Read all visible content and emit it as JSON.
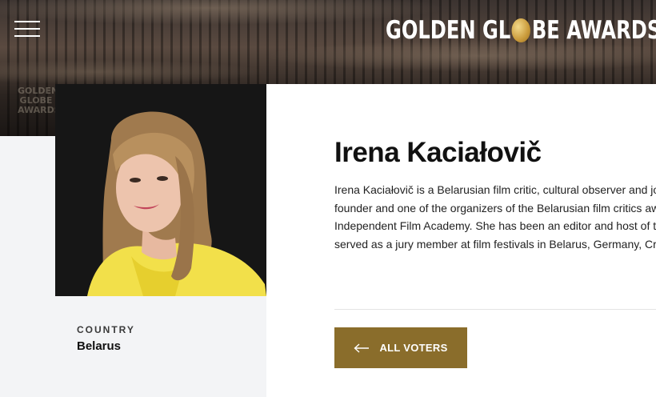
{
  "header": {
    "brand_left": "GOLDEN GL",
    "brand_right": "BE AWARDS",
    "brand_mark": "®",
    "ghost_logo_lines": [
      "GOLDEN",
      "GLOBE",
      "AWARDS"
    ]
  },
  "voter": {
    "name": "Irena Kaciałovič",
    "bio_lines": [
      "Irena Kaciałovič is a Belarusian film critic, cultural observer and journa",
      "founder and one of the organizers of the Belarusian film critics award",
      "Independent Film Academy. She has been an editor and host of the c",
      "served as a jury member at film festivals in Belarus, Germany, Croatia"
    ],
    "country_label": "COUNTRY",
    "country_value": "Belarus"
  },
  "actions": {
    "all_voters_label": "ALL VOTERS"
  },
  "colors": {
    "accent_gold": "#8a6d2b",
    "background_light": "#f3f4f6",
    "content_white": "#ffffff",
    "text_dark": "#111111"
  },
  "icons": {
    "menu": "hamburger-menu-icon",
    "back": "arrow-left-icon",
    "globe": "globe-icon"
  }
}
